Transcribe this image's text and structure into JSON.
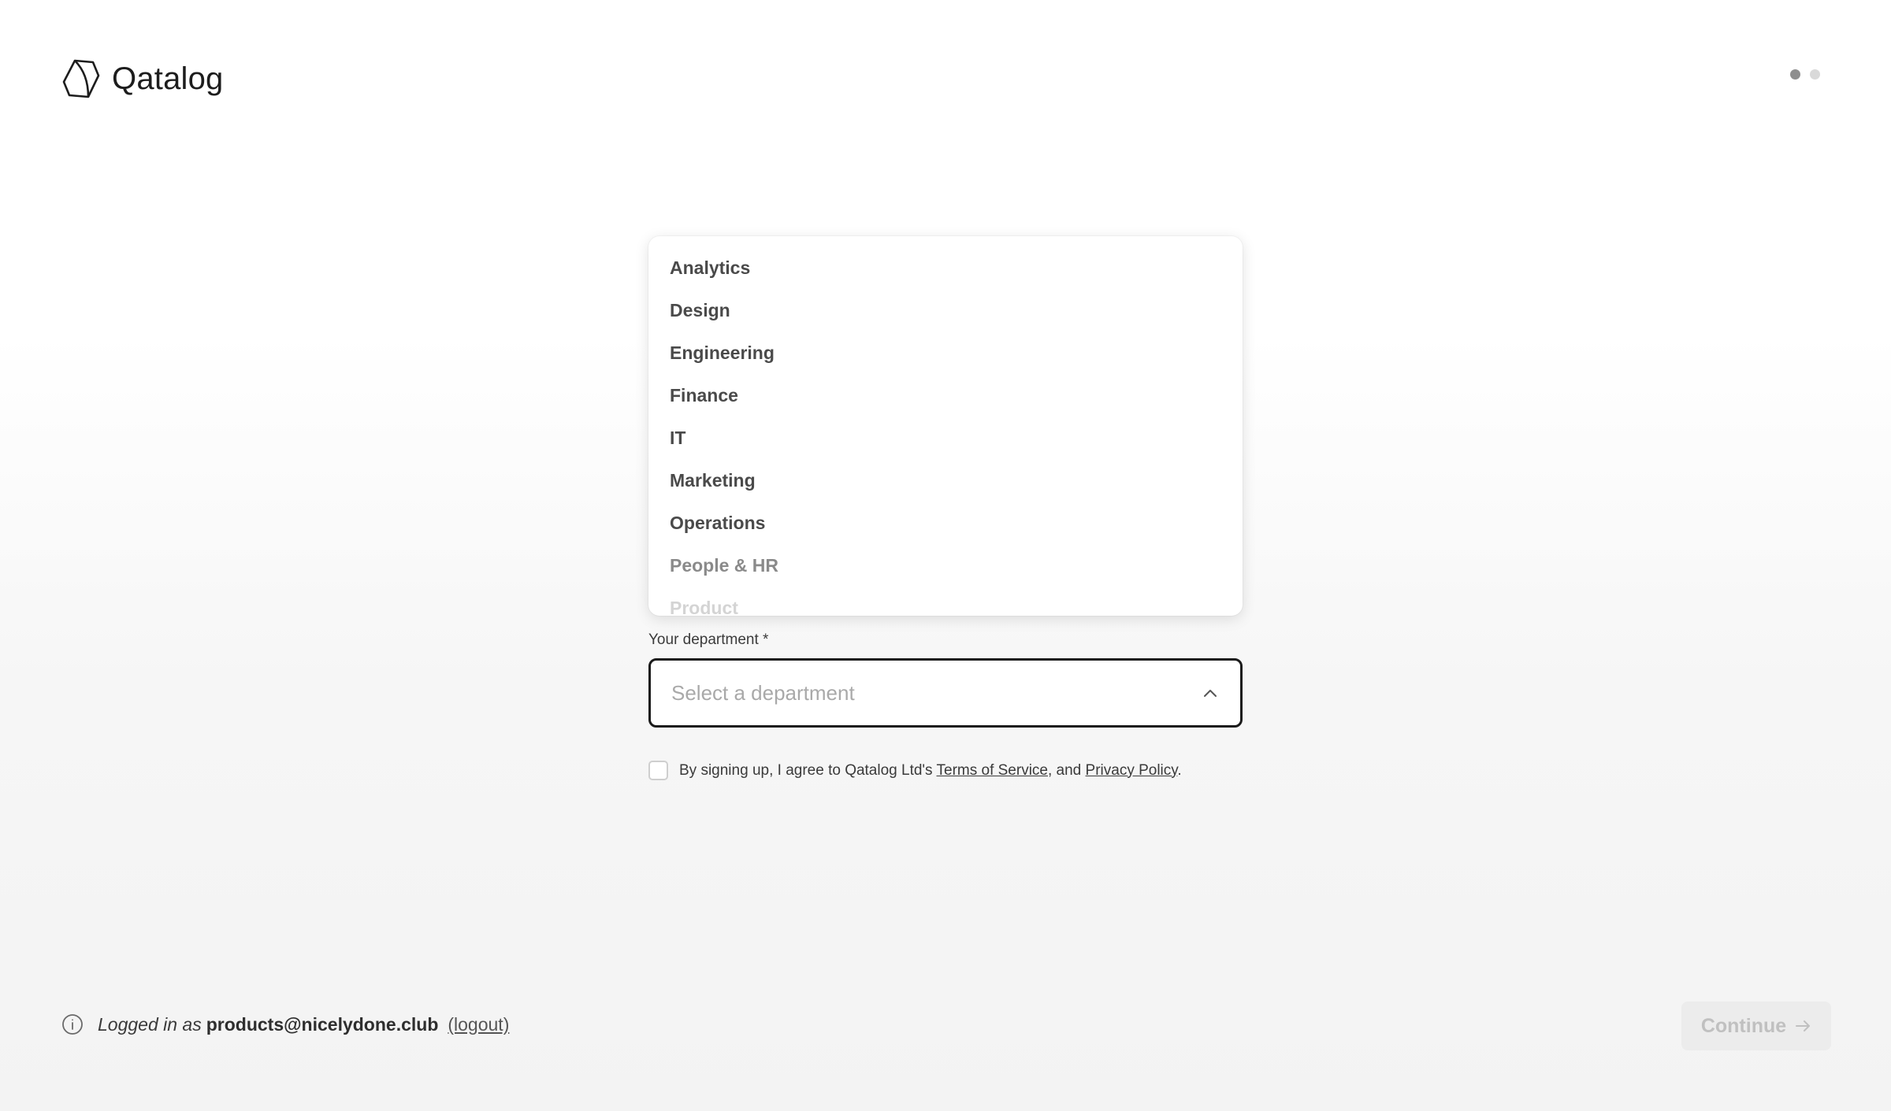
{
  "brand": {
    "name": "Qatalog",
    "icon": "qatalog-logo-icon"
  },
  "steps": {
    "total": 2,
    "current": 1
  },
  "department": {
    "label": "Your department *",
    "placeholder": "Select a department",
    "options": [
      "Analytics",
      "Design",
      "Engineering",
      "Finance",
      "IT",
      "Marketing",
      "Operations",
      "People & HR",
      "Product"
    ]
  },
  "terms": {
    "prefix": "By signing up, I agree to Qatalog Ltd's ",
    "terms_link": "Terms of Service",
    "middle": ", and ",
    "privacy_link": "Privacy Policy",
    "suffix": "."
  },
  "footer": {
    "logged_in_text": "Logged in as",
    "email": "products@nicelydone.club",
    "logout_label": "(logout)",
    "continue_label": "Continue"
  }
}
